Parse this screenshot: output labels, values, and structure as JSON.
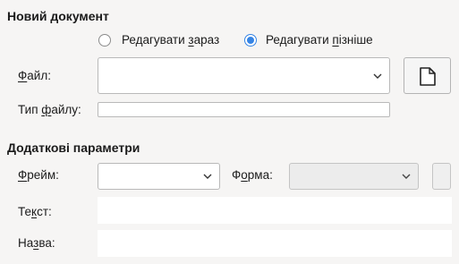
{
  "new_document": {
    "title": "Новий документ",
    "radio_now": {
      "pre": "Редагувати ",
      "underline": "з",
      "post": "араз",
      "checked": false
    },
    "radio_later": {
      "pre": "Редагувати ",
      "underline": "п",
      "post": "ізніше",
      "checked": true
    },
    "file_label": {
      "pre": "",
      "underline": "Ф",
      "post": "айл:"
    },
    "file_value": "",
    "file_type_label": {
      "pre": "Тип ",
      "underline": "ф",
      "post": "айлу:"
    },
    "file_type_value": "",
    "new_file_icon": "document-icon"
  },
  "extra_params": {
    "title": "Додаткові параметри",
    "frame_label": {
      "pre": "",
      "underline": "Ф",
      "post": "рейм:"
    },
    "frame_value": "",
    "form_label": {
      "pre": "Ф",
      "underline": "о",
      "post": "рма:"
    },
    "form_value": "",
    "text_label": {
      "pre": "Те",
      "underline": "к",
      "post": "ст:"
    },
    "text_value": "",
    "name_label": {
      "pre": "На",
      "underline": "з",
      "post": "ва:"
    },
    "name_value": ""
  },
  "colors": {
    "accent": "#3584e4",
    "background": "#f6f5f4"
  }
}
